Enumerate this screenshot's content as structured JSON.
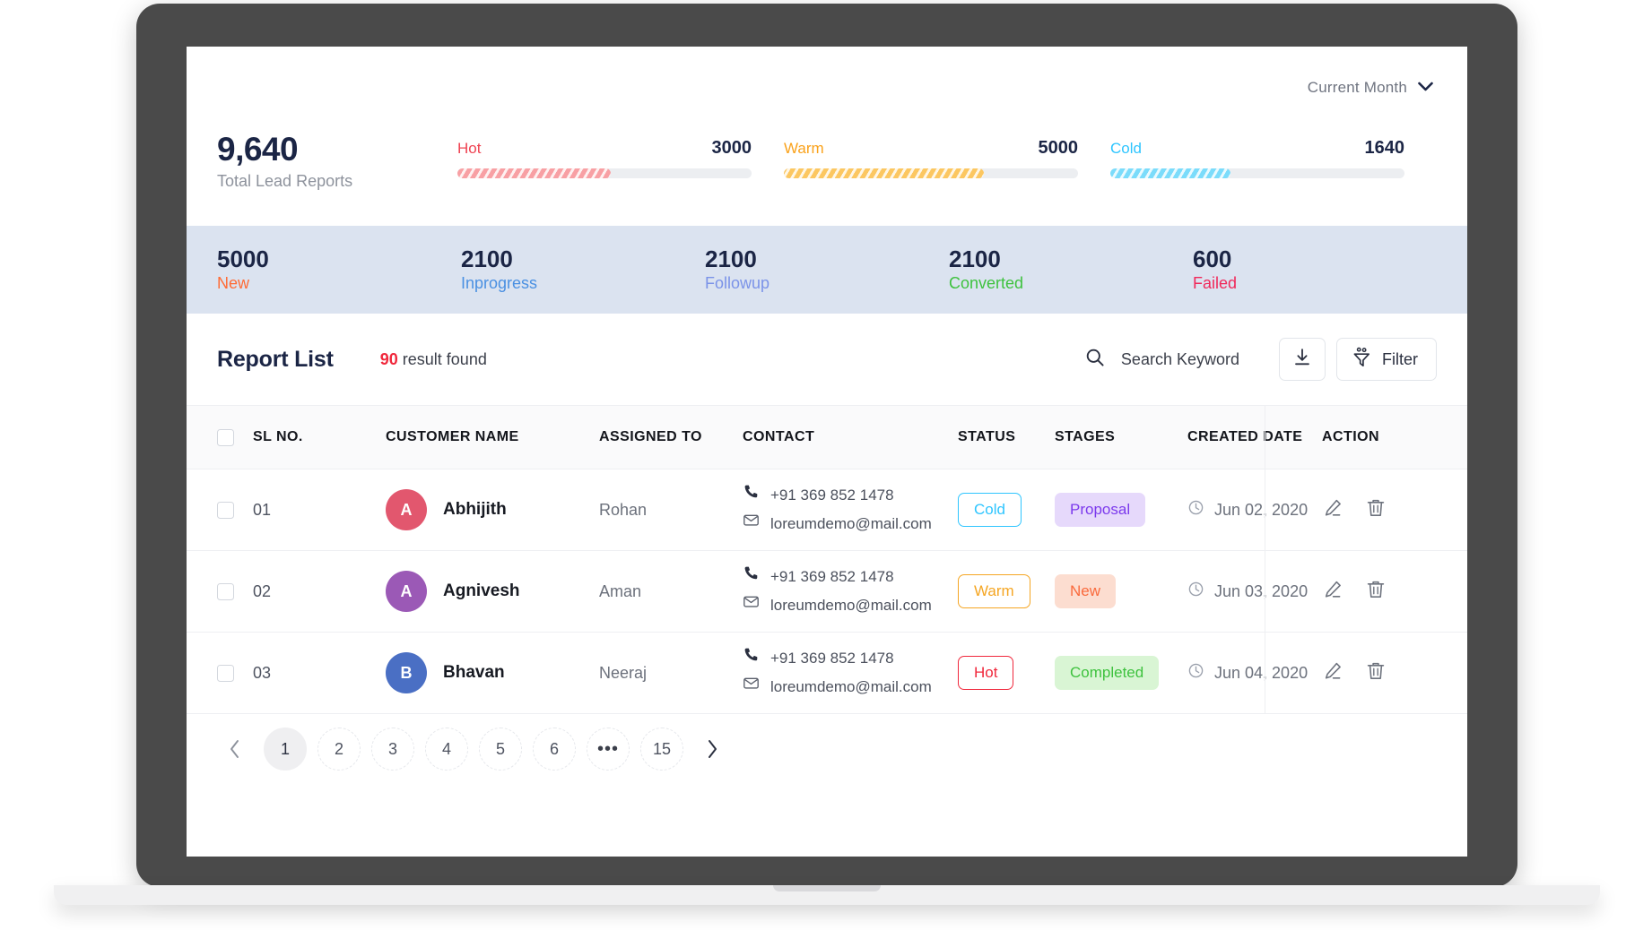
{
  "period_selector": {
    "label": "Current Month",
    "icon": "chevron-down-icon"
  },
  "summary": {
    "total_value": "9,640",
    "total_caption": "Total Lead Reports",
    "meters": [
      {
        "name": "Hot",
        "value": "3000",
        "color": "#ef4352",
        "fill_pct": 52
      },
      {
        "name": "Warm",
        "value": "5000",
        "color": "#faa21b",
        "fill_pct": 68
      },
      {
        "name": "Cold",
        "value": "1640",
        "color": "#2ec5ff",
        "fill_pct": 41
      }
    ]
  },
  "stages_strip": {
    "background": "#dbe3f0",
    "items": [
      {
        "count": "5000",
        "label": "New",
        "color": "#ff6b35"
      },
      {
        "count": "2100",
        "label": "Inprogress",
        "color": "#4a90e2"
      },
      {
        "count": "2100",
        "label": "Followup",
        "color": "#7b93e8"
      },
      {
        "count": "2100",
        "label": "Converted",
        "color": "#3ec23e"
      },
      {
        "count": "600",
        "label": "Failed",
        "color": "#f0285a"
      }
    ]
  },
  "report_list": {
    "title": "Report List",
    "result_count": "90",
    "result_suffix": " result found",
    "search": {
      "placeholder": "Search Keyword",
      "value": "",
      "icon": "search-icon"
    },
    "download_icon": "download-icon",
    "filter": {
      "label": "Filter",
      "icon": "filter-icon"
    }
  },
  "table": {
    "columns": [
      "SL NO.",
      "CUSTOMER NAME",
      "ASSIGNED TO",
      "CONTACT",
      "STATUS",
      "STAGES",
      "CREATED DATE",
      "ACTION"
    ],
    "rows": [
      {
        "sl": "01",
        "avatar_letter": "A",
        "avatar_color": "#e2576e",
        "customer_name": "Abhijith",
        "assigned_to": "Rohan",
        "phone": "+91 369 852 1478",
        "email": "loreumdemo@mail.com",
        "status": {
          "label": "Cold",
          "color": "#2ec5ff"
        },
        "stage": {
          "label": "Proposal",
          "color": "#7c3aed",
          "bg": "#e6d9fb"
        },
        "created_date": "Jun 02, 2020"
      },
      {
        "sl": "02",
        "avatar_letter": "A",
        "avatar_color": "#9b59b6",
        "customer_name": "Agnivesh",
        "assigned_to": "Aman",
        "phone": "+91 369 852 1478",
        "email": "loreumdemo@mail.com",
        "status": {
          "label": "Warm",
          "color": "#f5a623"
        },
        "stage": {
          "label": "New",
          "color": "#fa6a3c",
          "bg": "#fcddd0"
        },
        "created_date": "Jun 03, 2020"
      },
      {
        "sl": "03",
        "avatar_letter": "B",
        "avatar_color": "#4a6fc4",
        "customer_name": "Bhavan",
        "assigned_to": "Neeraj",
        "phone": "+91 369 852 1478",
        "email": "loreumdemo@mail.com",
        "status": {
          "label": "Hot",
          "color": "#f0283c"
        },
        "stage": {
          "label": "Completed",
          "color": "#3ec23e",
          "bg": "#d9f5d4"
        },
        "created_date": "Jun 04, 2020"
      }
    ],
    "row_icons": {
      "phone": "phone-icon",
      "email": "mail-icon",
      "clock": "clock-icon",
      "edit": "edit-pencil-icon",
      "delete": "trash-icon"
    }
  },
  "pagination": {
    "prev_icon": "chevron-left-icon",
    "next_icon": "chevron-right-icon",
    "pages": [
      "1",
      "2",
      "3",
      "4",
      "5",
      "6",
      "•••",
      "15"
    ],
    "active_page": "1"
  }
}
